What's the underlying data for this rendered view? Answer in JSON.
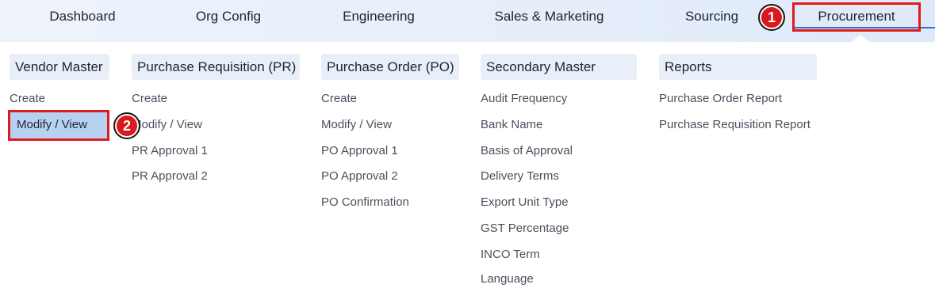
{
  "nav": {
    "items": [
      "Dashboard",
      "Org Config",
      "Engineering",
      "Sales & Marketing",
      "Sourcing",
      "Procurement"
    ]
  },
  "badges": [
    "1",
    "2"
  ],
  "columns": [
    {
      "title": "Vendor Master",
      "items": [
        "Create",
        "Modify / View"
      ]
    },
    {
      "title": "Purchase Requisition (PR)",
      "items": [
        "Create",
        "Modify / View",
        "PR Approval 1",
        "PR Approval 2"
      ]
    },
    {
      "title": "Purchase Order (PO)",
      "items": [
        "Create",
        "Modify / View",
        "PO Approval 1",
        "PO Approval 2",
        "PO Confirmation"
      ]
    },
    {
      "title": "Secondary Master",
      "items": [
        "Audit Frequency",
        "Bank Name",
        "Basis of Approval",
        "Delivery Terms",
        "Export Unit Type",
        "GST Percentage",
        "INCO Term",
        "Language"
      ]
    },
    {
      "title": "Reports",
      "items": [
        "Purchase Order Report",
        "Purchase Requisition Report"
      ]
    }
  ],
  "colors": {
    "highlight": "#e01b1b",
    "selected_bg": "#b7d2f1",
    "header_bg": "#e8eff9",
    "accent": "#2f6fd6"
  }
}
